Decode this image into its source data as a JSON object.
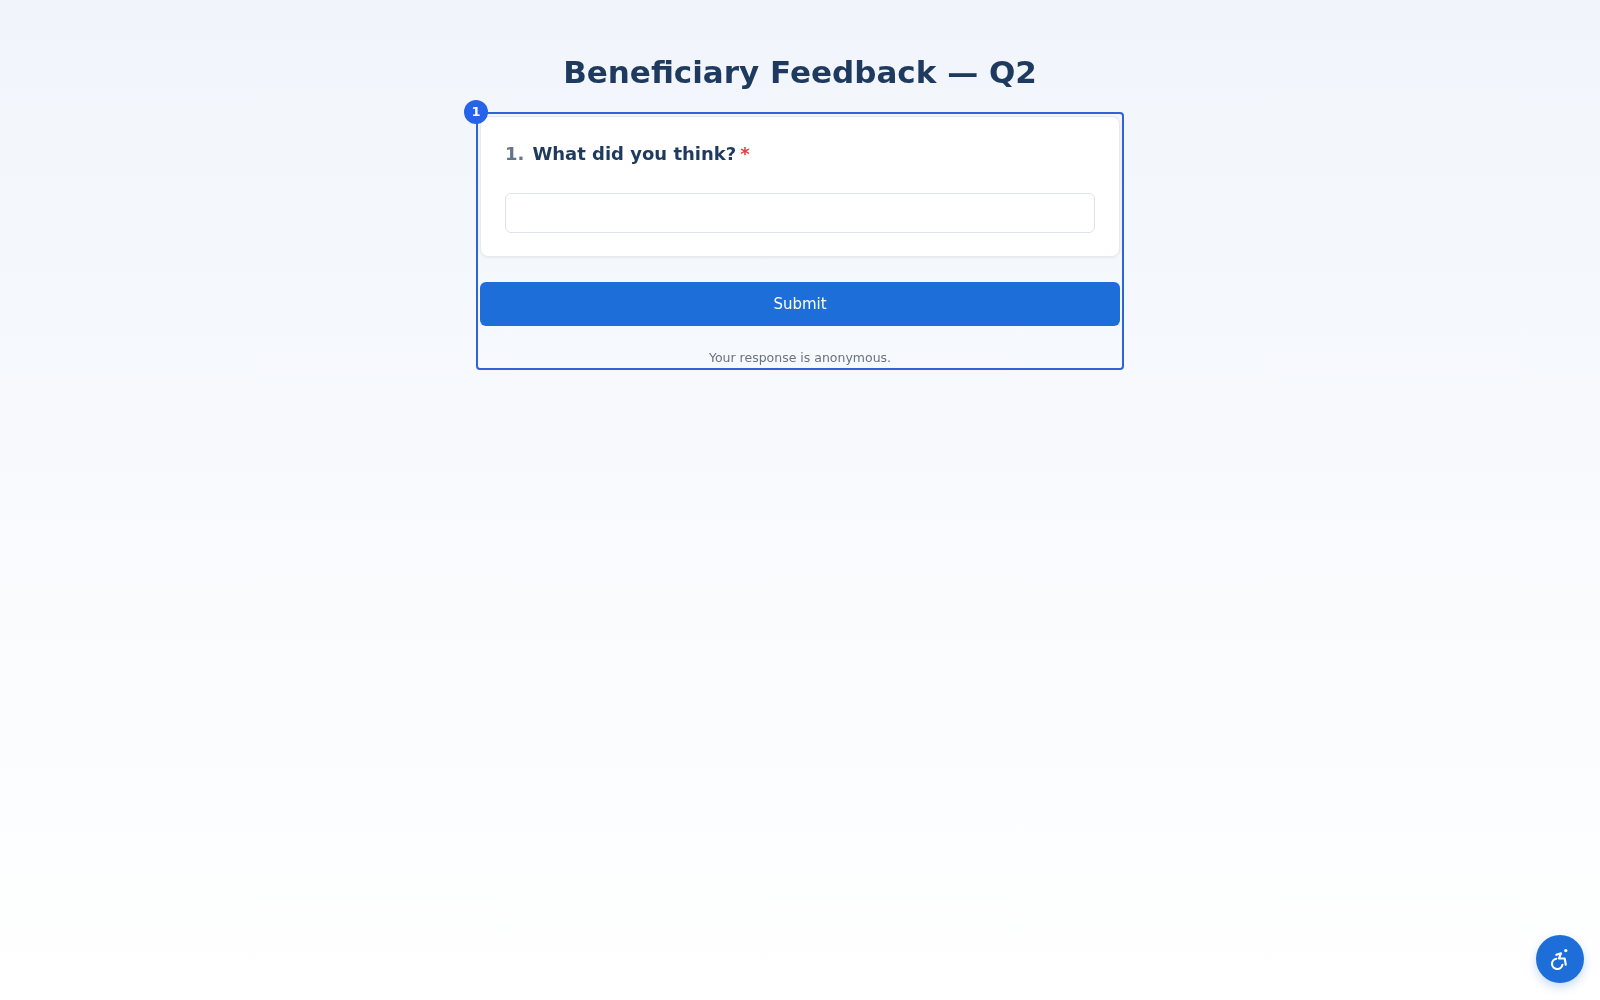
{
  "page": {
    "title": "Beneficiary Feedback — Q2"
  },
  "highlight": {
    "badge": "1"
  },
  "questions": [
    {
      "kind": "text",
      "number": "1.",
      "text": "What did you think?",
      "required": true,
      "required_mark": "*"
    }
  ],
  "submit": {
    "label": "Submit"
  },
  "footer_note": "Your response is anonymous."
}
